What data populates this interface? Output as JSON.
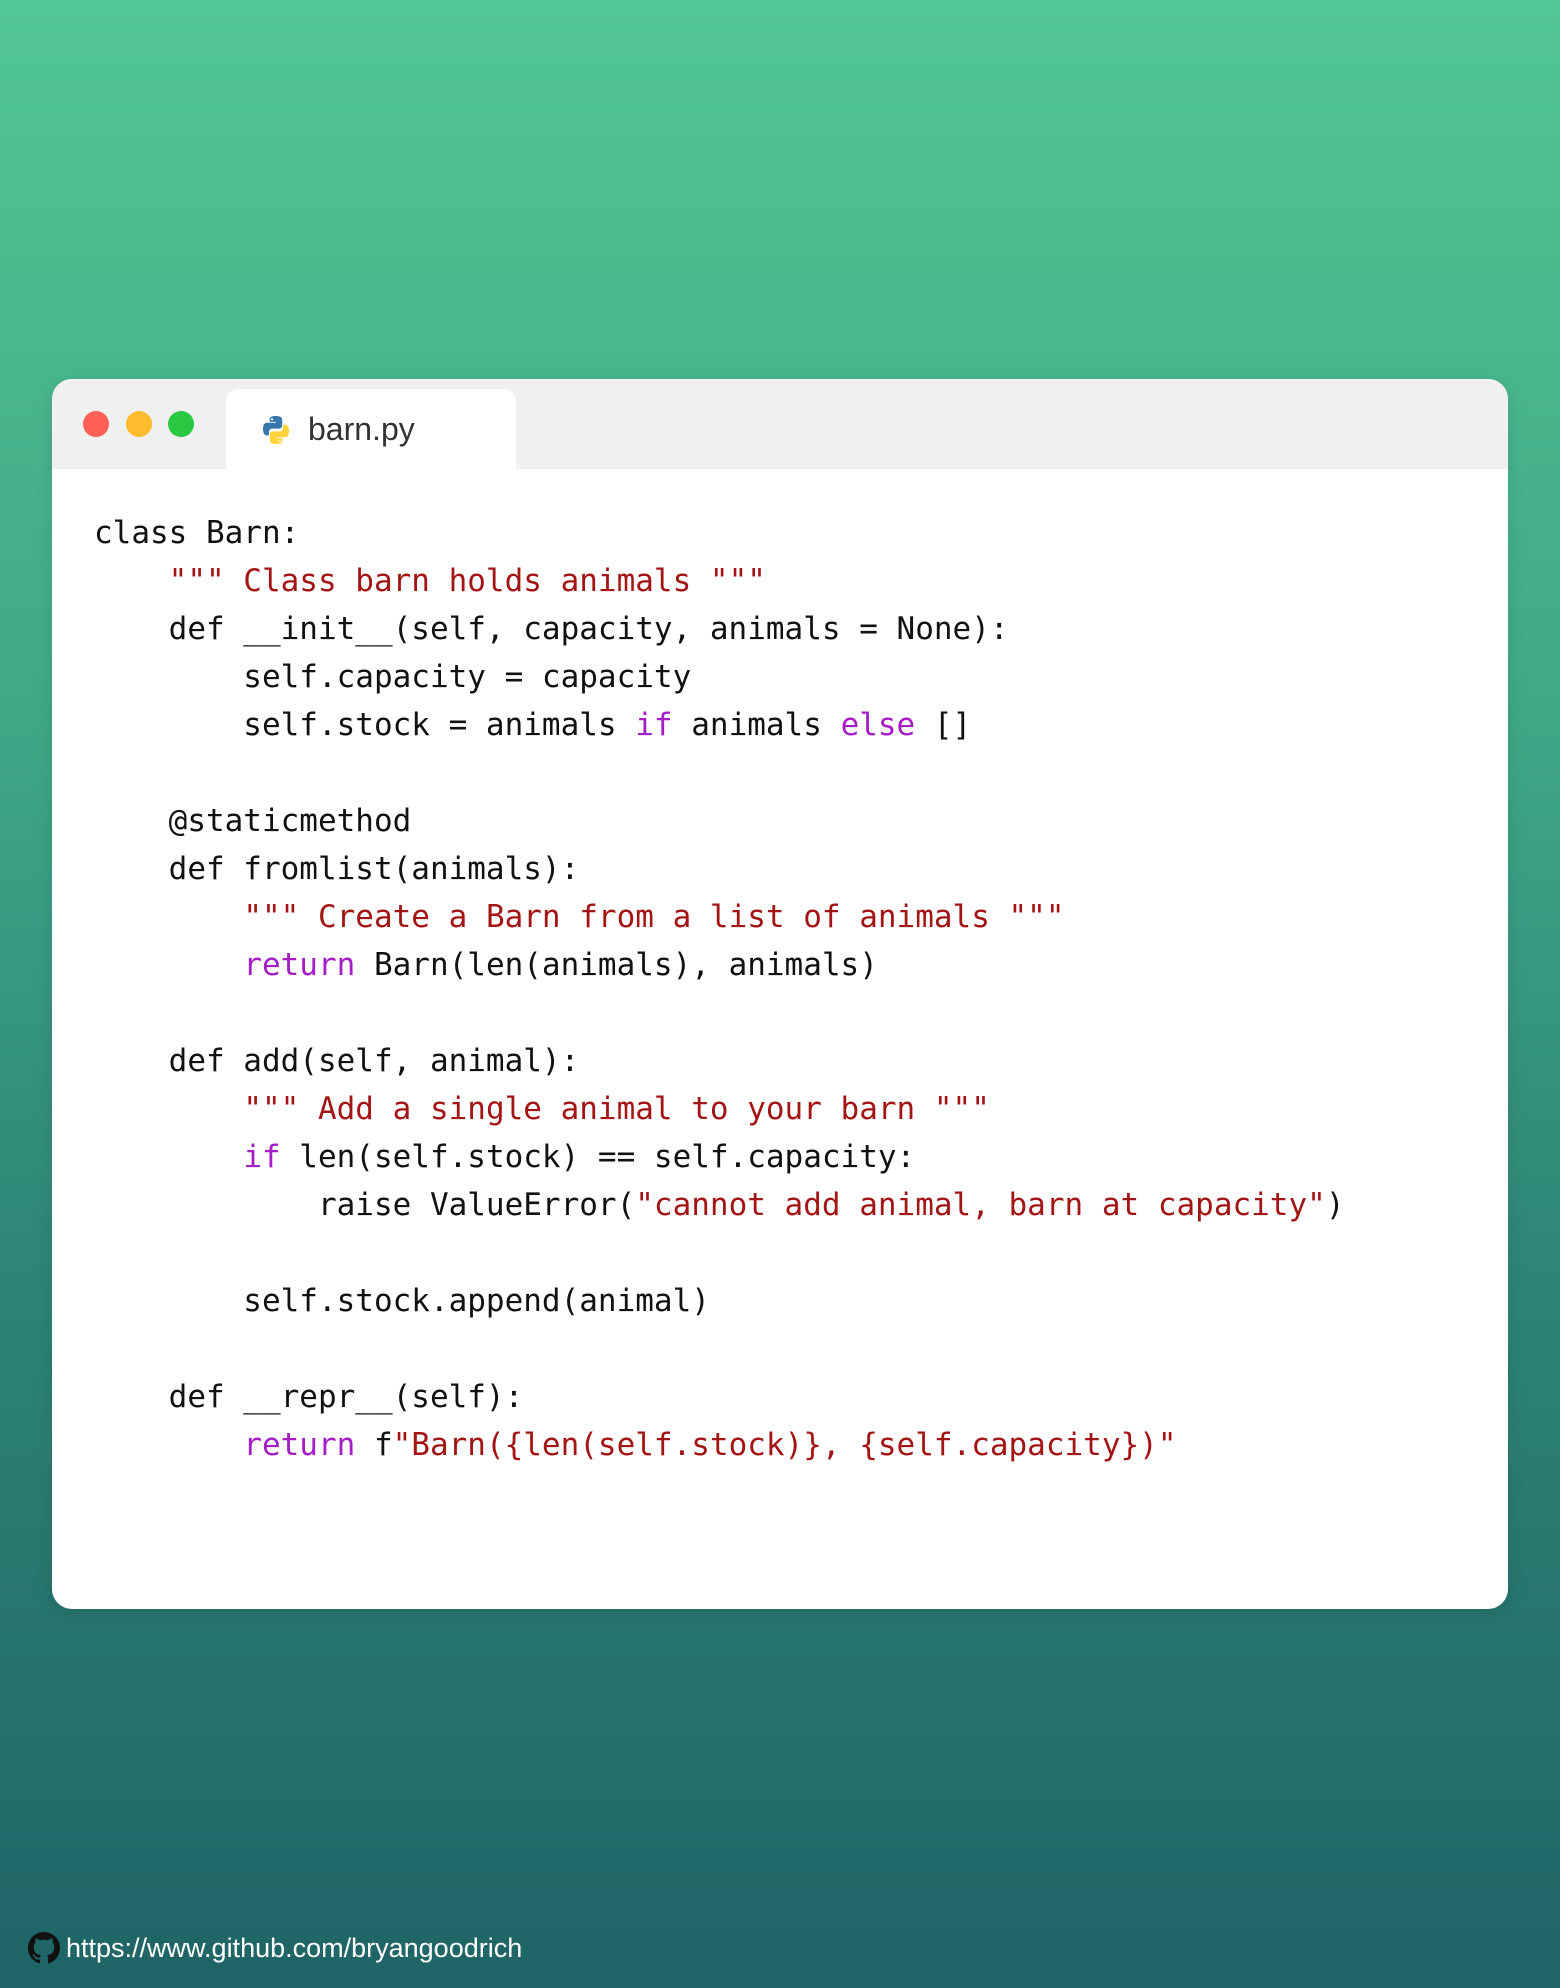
{
  "window": {
    "controls": [
      "close",
      "minimize",
      "maximize"
    ],
    "tab": {
      "label": "barn.py",
      "icon": "python-icon"
    }
  },
  "colors": {
    "text": "#111111",
    "keyword": "#a51dc5",
    "string": "#a31515",
    "background_top": "#52c693",
    "background_bottom": "#206466"
  },
  "code": {
    "language": "python",
    "lines": [
      [
        {
          "t": "txt",
          "v": "class Barn:"
        }
      ],
      [
        {
          "t": "txt",
          "v": "    "
        },
        {
          "t": "str",
          "v": "\"\"\" Class barn holds animals \"\"\""
        }
      ],
      [
        {
          "t": "txt",
          "v": "    def __init__(self, capacity, animals = None):"
        }
      ],
      [
        {
          "t": "txt",
          "v": "        self.capacity = capacity"
        }
      ],
      [
        {
          "t": "txt",
          "v": "        self.stock = animals "
        },
        {
          "t": "kw",
          "v": "if"
        },
        {
          "t": "txt",
          "v": " animals "
        },
        {
          "t": "kw",
          "v": "else"
        },
        {
          "t": "txt",
          "v": " []"
        }
      ],
      [],
      [
        {
          "t": "txt",
          "v": "    @staticmethod"
        }
      ],
      [
        {
          "t": "txt",
          "v": "    def fromlist(animals):"
        }
      ],
      [
        {
          "t": "txt",
          "v": "        "
        },
        {
          "t": "str",
          "v": "\"\"\" Create a Barn from a list of animals \"\"\""
        }
      ],
      [
        {
          "t": "txt",
          "v": "        "
        },
        {
          "t": "kw",
          "v": "return"
        },
        {
          "t": "txt",
          "v": " Barn(len(animals), animals)"
        }
      ],
      [],
      [
        {
          "t": "txt",
          "v": "    def add(self, animal):"
        }
      ],
      [
        {
          "t": "txt",
          "v": "        "
        },
        {
          "t": "str",
          "v": "\"\"\" Add a single animal to your barn \"\"\""
        }
      ],
      [
        {
          "t": "txt",
          "v": "        "
        },
        {
          "t": "kw",
          "v": "if"
        },
        {
          "t": "txt",
          "v": " len(self.stock) == self.capacity:"
        }
      ],
      [
        {
          "t": "txt",
          "v": "            raise ValueError("
        },
        {
          "t": "str",
          "v": "\"cannot add animal, barn at capacity\""
        },
        {
          "t": "txt",
          "v": ")"
        }
      ],
      [],
      [
        {
          "t": "txt",
          "v": "        self.stock.append(animal)"
        }
      ],
      [],
      [
        {
          "t": "txt",
          "v": "    def __repr__(self):"
        }
      ],
      [
        {
          "t": "txt",
          "v": "        "
        },
        {
          "t": "kw",
          "v": "return"
        },
        {
          "t": "txt",
          "v": " f"
        },
        {
          "t": "str",
          "v": "\"Barn({len(self.stock)}, {self.capacity})\""
        }
      ]
    ]
  },
  "footer": {
    "icon": "github-icon",
    "link": "https://www.github.com/bryangoodrich"
  }
}
